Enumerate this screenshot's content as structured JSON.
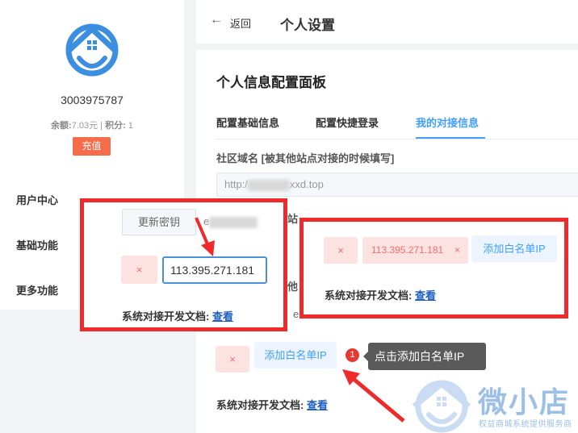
{
  "sidebar": {
    "user_id": "3003975787",
    "balance_label": "余额:",
    "balance_value": "7.03元",
    "points_label": "积分:",
    "points_value": "1",
    "recharge_label": "充值",
    "menu": [
      "用户中心",
      "基础功能",
      "更多功能"
    ]
  },
  "header": {
    "back_label": "返回",
    "title": "个人设置"
  },
  "panel": {
    "title": "个人信息配置面板",
    "tabs": [
      "配置基础信息",
      "配置快捷登录",
      "我的对接信息"
    ],
    "active_tab": "我的对接信息",
    "domain_label": "社区域名 [被其他站点对接的时候填写]",
    "domain_value_prefix": "http:/",
    "domain_value_suffix": "xxd.top",
    "partial_label_1": "站",
    "partial_label_2": "他",
    "partial_text_3": "e",
    "remove_ip_symbol": "×",
    "add_whitelist_label": "添加白名单IP",
    "doc_label": "系统对接开发文档:",
    "doc_link": "查看",
    "step_number": "1",
    "tooltip": "点击添加白名单IP"
  },
  "callout_left": {
    "renew_secret_label": "更新密钥",
    "secret_partial": "e",
    "ip_input_value": "113.395.271.181",
    "remove_ip_symbol": "×",
    "doc_label": "系统对接开发文档:",
    "doc_link": "查看"
  },
  "callout_right": {
    "ip_tag_value": "113.395.271.181",
    "remove_ip_symbol": "×",
    "add_whitelist_label": "添加白名单IP",
    "doc_label": "系统对接开发文档:",
    "doc_link": "查看"
  },
  "watermark": {
    "brand": "微小店",
    "subtitle": "权益商城系统提供服务商"
  },
  "colors": {
    "accent": "#409eff",
    "callout_border": "#ee2a2a",
    "recharge": "#f56c4b",
    "ip_tag_bg": "#fde2e2"
  }
}
